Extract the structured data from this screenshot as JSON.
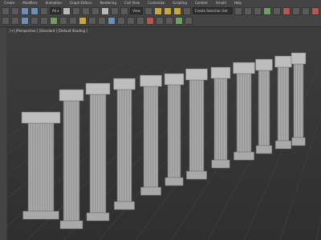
{
  "menu": [
    "Create",
    "Modifiers",
    "Animation",
    "Graph Editors",
    "Rendering",
    "Civil View",
    "Customize",
    "Scripting",
    "Content",
    "Arnold",
    "Help"
  ],
  "toolbar": {
    "selection_set": "Create Selection Set",
    "view_combo": "View"
  },
  "viewport": {
    "label": "[+] [Perspective ] [Standard ] [Default Shading ]"
  },
  "colors": {
    "ui_bg": "#444444",
    "viewport_bg": "#363636",
    "column": "#c4c4c4",
    "column_shade": "#9a9a9a"
  },
  "icons": [
    "undo-icon",
    "redo-icon",
    "link-icon",
    "unlink-icon",
    "select-icon",
    "move-icon",
    "rotate-icon",
    "scale-icon",
    "snap-icon",
    "render-icon"
  ]
}
